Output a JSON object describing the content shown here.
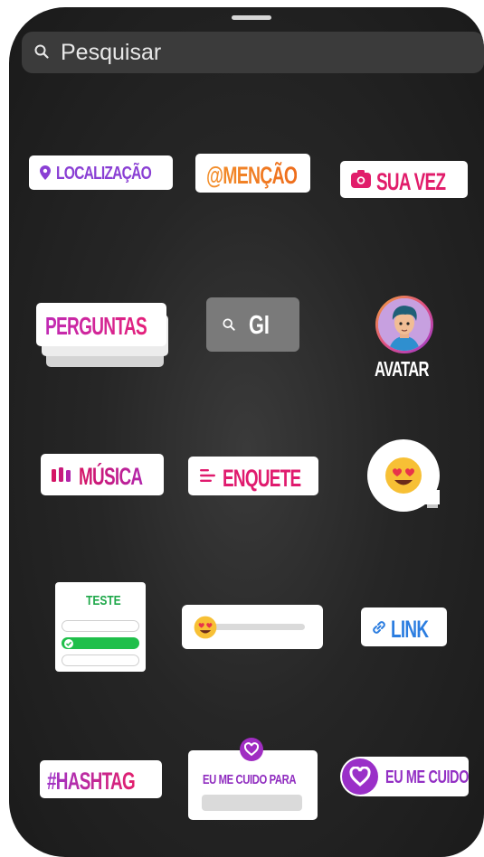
{
  "search": {
    "placeholder": "Pesquisar"
  },
  "stickers": {
    "location": "LOCALIZAÇÃO",
    "mention": "@MENÇÃO",
    "your_turn": "SUA VEZ",
    "questions": "PERGUNTAS",
    "gif": "GI",
    "avatar": "AVATAR",
    "music": "MÚSICA",
    "poll": "ENQUETE",
    "quiz": "TESTE",
    "link": "LINK",
    "hashtag": "#HASHTAG",
    "self_care_prompt": "EU ME CUIDO PARA",
    "self_care": "EU ME CUIDO"
  },
  "quiz": {
    "correct_option_index": 1
  },
  "emoji_slider": {
    "level": 0
  },
  "icons": [
    "search-icon",
    "location-pin-icon",
    "camera-icon",
    "music-bars-icon",
    "poll-lines-icon",
    "link-icon",
    "heart-eyes-emoji-icon",
    "check-icon",
    "heart-badge-icon"
  ],
  "colors": {
    "background": "#262626",
    "search_bg": "#3b3b3b",
    "pink": "#e01b6e",
    "purple": "#8a3fd4",
    "orange": "#f07a1f",
    "blue": "#2b7de0",
    "green": "#1fbf4a"
  }
}
